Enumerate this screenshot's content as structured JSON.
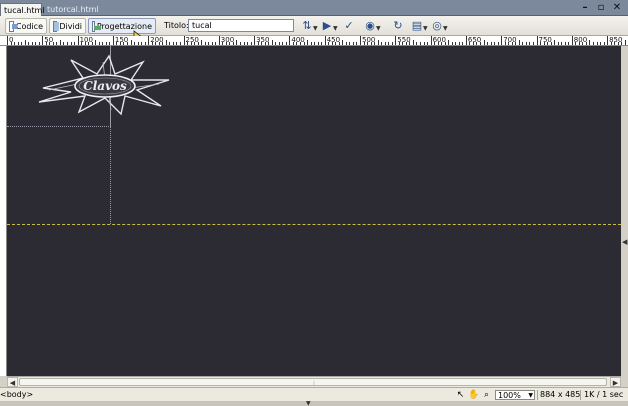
{
  "tabs": [
    {
      "label": "tucal.html",
      "active": true
    },
    {
      "label": "tutorcal.html",
      "active": false
    }
  ],
  "window_controls": {
    "minimize": "–",
    "restore": "▫",
    "close": "✕"
  },
  "toolbar": {
    "code_label": "Codice",
    "split_label": "Dividi",
    "design_label": "Progettazione",
    "title_label": "Titolo:",
    "title_value": "tucal"
  },
  "toolbar_icons": [
    "file-management-icon",
    "preview-icon",
    "refresh-icon",
    "view-options-icon",
    "visual-aids-icon",
    "validate-icon",
    "browser-check-icon"
  ],
  "ruler": {
    "labels": [
      "0",
      "50",
      "100",
      "150",
      "200",
      "250",
      "300",
      "350",
      "400",
      "450",
      "500",
      "550",
      "600",
      "650",
      "700",
      "750",
      "800",
      "850"
    ]
  },
  "logo": {
    "text": "Clavos"
  },
  "statusbar": {
    "tag": "<body>",
    "zoom": "100%",
    "dimensions": "884 x 485",
    "download": "1K / 1 sec"
  },
  "colors": {
    "canvas_bg": "#2c2a33",
    "guide": "#c8c040",
    "tab_strip": "#7c889c"
  }
}
